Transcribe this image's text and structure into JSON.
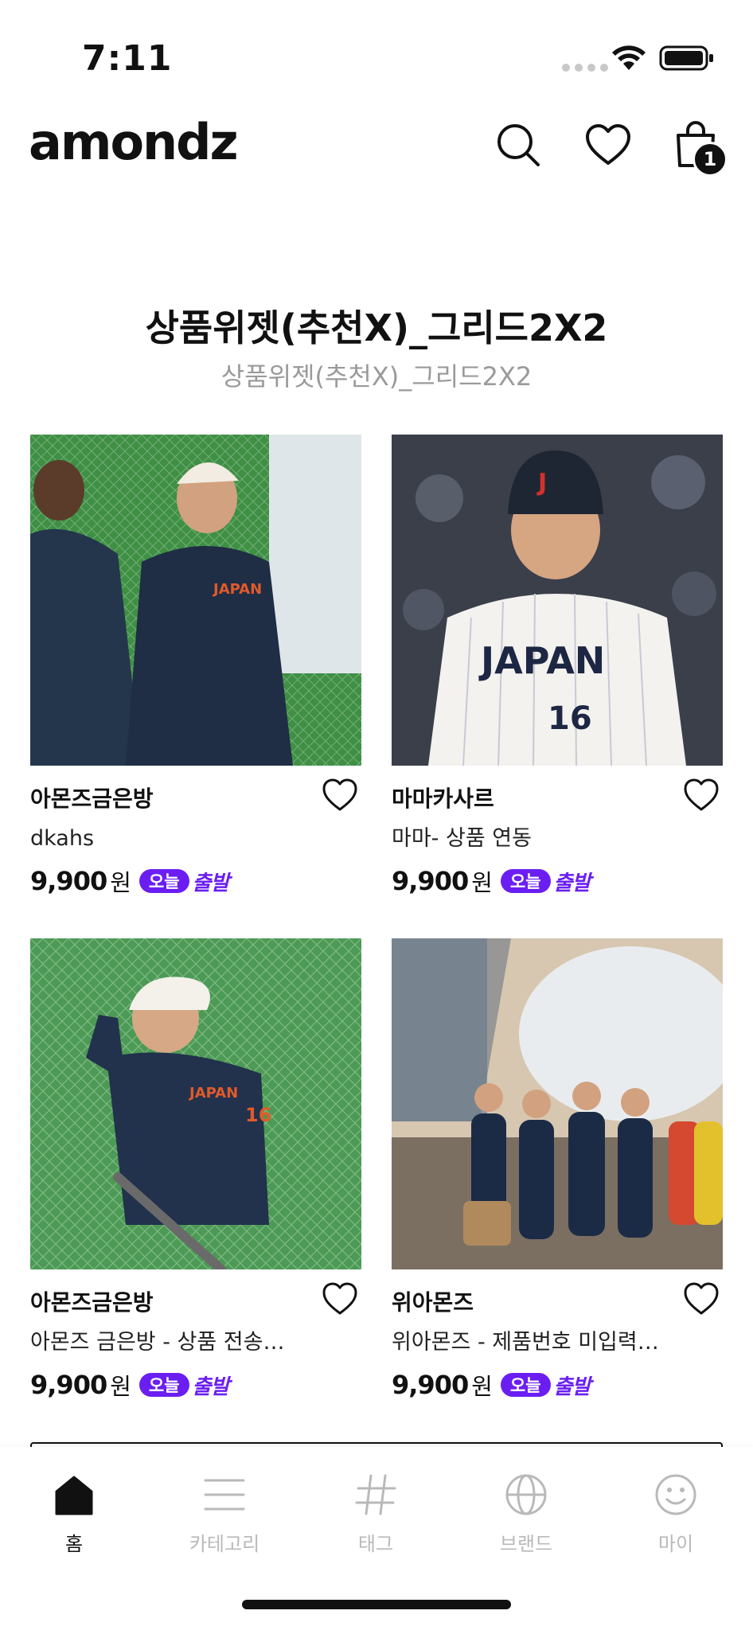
{
  "status_bar": {
    "time": "7:11"
  },
  "header": {
    "logo": "amondz",
    "cart_count": "1"
  },
  "section": {
    "title": "상품위젯(추천X)_그리드2X2",
    "subtitle": "상품위젯(추천X)_그리드2X2"
  },
  "products": [
    {
      "brand": "아몬즈금은방",
      "name": "dkahs",
      "price": "9,900",
      "currency": "원",
      "badge_today": "오늘",
      "badge_depart": "출발"
    },
    {
      "brand": "마마카사르",
      "name": "마마- 상품 연동",
      "price": "9,900",
      "currency": "원",
      "badge_today": "오늘",
      "badge_depart": "출발"
    },
    {
      "brand": "아몬즈금은방",
      "name": "아몬즈 금은방 - 상품 전송…",
      "price": "9,900",
      "currency": "원",
      "badge_today": "오늘",
      "badge_depart": "출발"
    },
    {
      "brand": "위아몬즈",
      "name": "위아몬즈 - 제품번호 미입력…",
      "price": "9,900",
      "currency": "원",
      "badge_today": "오늘",
      "badge_depart": "출발"
    }
  ],
  "tabs": [
    {
      "label": "홈",
      "icon": "home-icon",
      "active": true
    },
    {
      "label": "카테고리",
      "icon": "menu-icon",
      "active": false
    },
    {
      "label": "태그",
      "icon": "hash-icon",
      "active": false
    },
    {
      "label": "브랜드",
      "icon": "globe-icon",
      "active": false
    },
    {
      "label": "마이",
      "icon": "smile-icon",
      "active": false
    }
  ],
  "colors": {
    "accent": "#6b1ef2",
    "text": "#111111",
    "muted": "#9a9a9a"
  }
}
